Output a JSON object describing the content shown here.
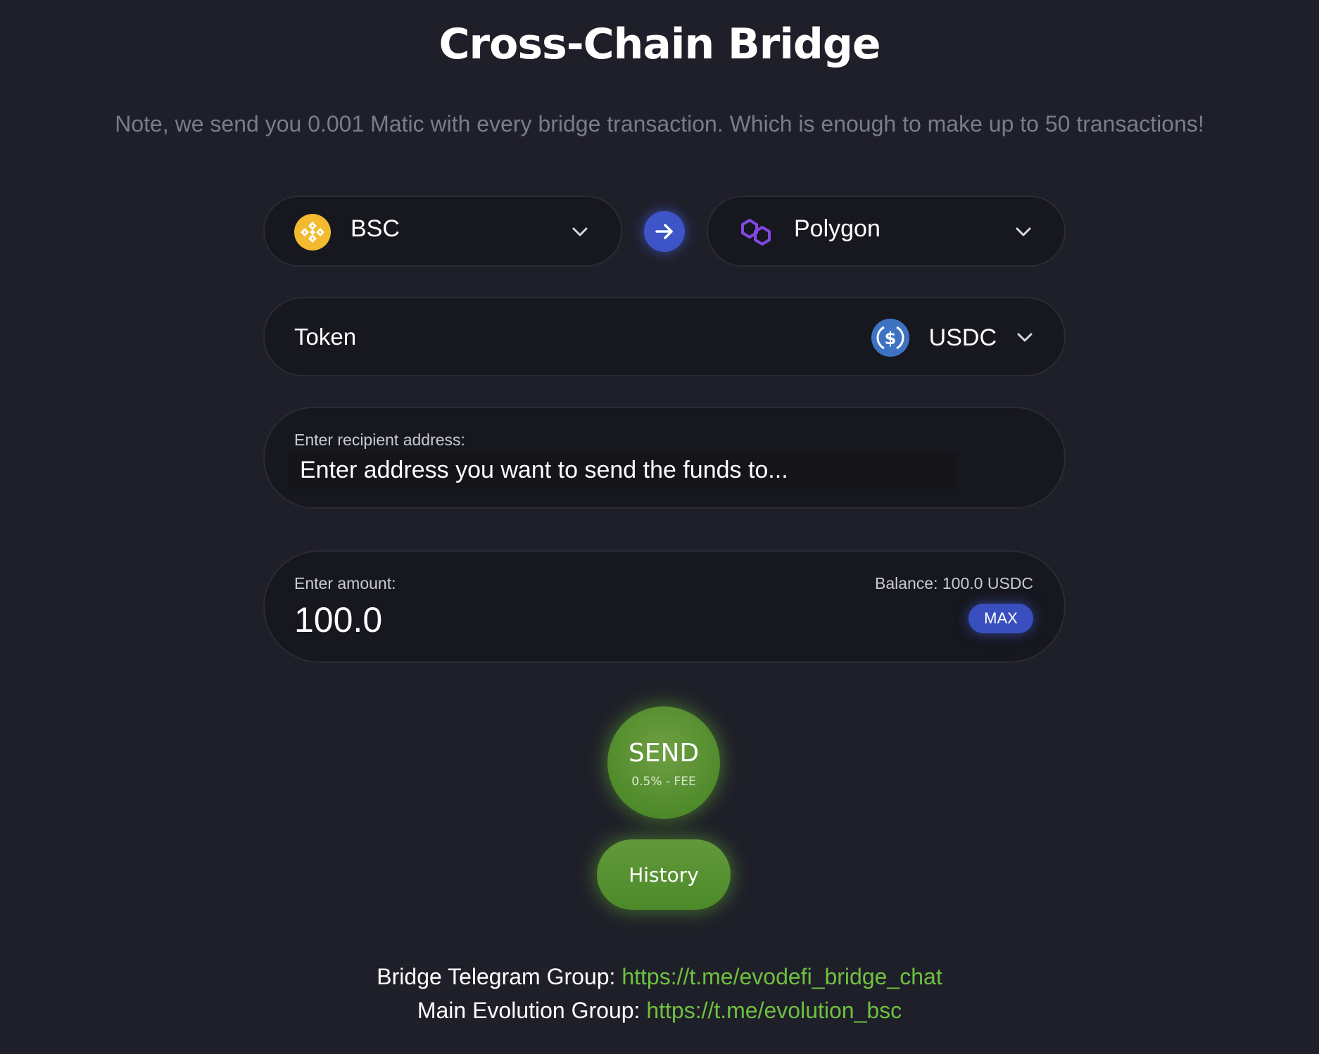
{
  "header": {
    "title": "Cross-Chain Bridge",
    "note": "Note, we send you 0.001 Matic with every bridge transaction. Which is enough to make up to 50 transactions!"
  },
  "chains": {
    "from": {
      "label": "BSC",
      "icon": "binance-icon",
      "color": "#F3BA2F"
    },
    "to": {
      "label": "Polygon",
      "icon": "polygon-icon",
      "color": "#8247E5"
    },
    "swap_icon": "arrow-right-icon"
  },
  "token": {
    "label": "Token",
    "selected": "USDC",
    "icon": "usdc-icon",
    "color": "#3E73C4"
  },
  "recipient": {
    "label": "Enter recipient address:",
    "placeholder": "Enter address you want to send the funds to..."
  },
  "amount": {
    "label": "Enter amount:",
    "value": "100.0",
    "balance": "Balance: 100.0 USDC",
    "max_label": "MAX"
  },
  "actions": {
    "send_label": "SEND",
    "send_fee": "0.5% - FEE",
    "history_label": "History"
  },
  "footer": {
    "telegram_label": "Bridge Telegram Group: ",
    "telegram_url": "https://t.me/evodefi_bridge_chat",
    "main_label": "Main Evolution Group: ",
    "main_url": "https://t.me/evolution_bsc"
  },
  "colors": {
    "background": "#1f1f29",
    "accent_blue": "#3d55c7",
    "accent_green": "#4f8a2b",
    "link_green": "#6ec13f"
  }
}
